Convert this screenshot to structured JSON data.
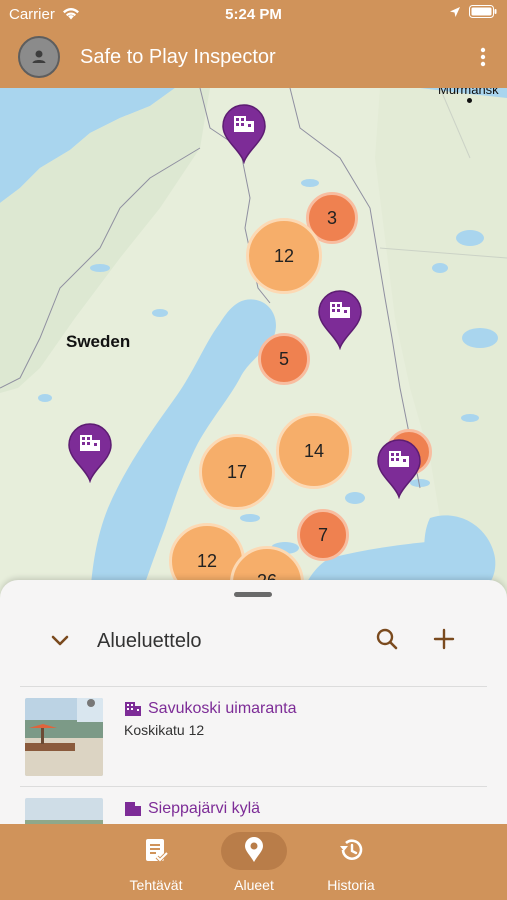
{
  "status": {
    "carrier": "Carrier",
    "time": "5:24 PM"
  },
  "appbar": {
    "title": "Safe to Play Inspector"
  },
  "map": {
    "labels": {
      "sweden": "Sweden",
      "murmansk": "Murmansk"
    },
    "clusters": [
      "3",
      "12",
      "5",
      "14",
      "17",
      "7",
      "12",
      "26"
    ]
  },
  "sheet": {
    "title": "Alueluettelo",
    "items": [
      {
        "name": "Savukoski uimaranta",
        "address": "Koskikatu 12"
      },
      {
        "name": "Sieppajärvi kylä",
        "address": ""
      }
    ]
  },
  "tabs": [
    {
      "label": "Tehtävät",
      "icon": "tasks-icon"
    },
    {
      "label": "Alueet",
      "icon": "location-pin-icon"
    },
    {
      "label": "Historia",
      "icon": "history-icon"
    }
  ],
  "colors": {
    "accent": "#d0935a",
    "pin": "#7d2c97",
    "cluster_big": "#f6ae6a",
    "cluster_small": "#ef8150"
  }
}
